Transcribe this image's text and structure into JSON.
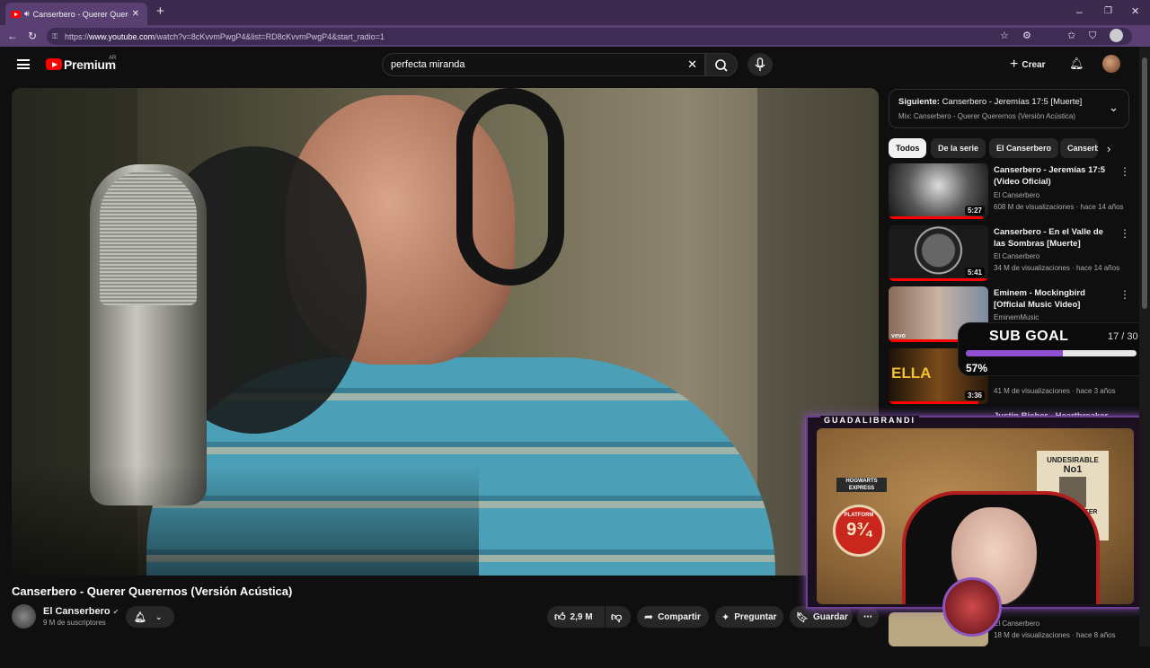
{
  "browser": {
    "tab_title": "Canserbero - Querer Querernos",
    "url_prefix": "https://",
    "url_domain": "www.youtube.com",
    "url_path": "/watch?v=8cKvvmPwgP4&list=RD8cKvvmPwgP4&start_radio=1"
  },
  "header": {
    "logo": "Premium",
    "region": "AR",
    "search_value": "perfecta miranda",
    "create_label": "Crear"
  },
  "video": {
    "title": "Canserbero - Querer Querernos (Versión Acústica)",
    "channel": "El Canserbero",
    "subscribers": "9 M de suscriptores",
    "likes": "2,9 M",
    "share": "Compartir",
    "ask": "Preguntar",
    "save": "Guardar"
  },
  "playlist": {
    "next_label": "Siguiente:",
    "next_title": "Canserbero - Jeremías 17:5 [Muerte]",
    "mix": "Mix: Canserbero - Querer Querernos (Versión Acústica)"
  },
  "chips": [
    "Todos",
    "De la serie",
    "El Canserbero",
    "Canserbero"
  ],
  "sidebar": [
    {
      "title": "Canserbero - Jeremías 17:5 (Video Oficial)",
      "channel": "El Canserbero",
      "meta": "608 M de visualizaciones · hace 14 años",
      "duration": "5:27",
      "progress": 0.95
    },
    {
      "title": "Canserbero - En el Valle de las Sombras [Muerte]",
      "channel": "El Canserbero",
      "meta": "34 M de visualizaciones · hace 14 años",
      "duration": "5:41",
      "progress": 1.0
    },
    {
      "title": "Eminem - Mockingbird [Official Music Video]",
      "channel": "EminemMusic",
      "meta": "",
      "duration": "",
      "progress": 0.9
    },
    {
      "title": "",
      "channel": "",
      "meta": "41 M de visualizaciones · hace 3 años",
      "duration": "3:36",
      "progress": 0.9
    },
    {
      "title": "Justin Bieber - Heartbreaker",
      "channel": "",
      "meta": "",
      "duration": "",
      "progress": 0
    },
    {
      "title": "",
      "channel": "El Canserbero",
      "meta": "18 M de visualizaciones · hace 8 años",
      "duration": "",
      "progress": 0
    }
  ],
  "overlay": {
    "goal_label": "SUB GOAL",
    "goal_count": "17 / 30",
    "goal_percent": "57%",
    "goal_fraction": 0.57,
    "streamer": "GUADALIBRANDI",
    "poster_line1": "UNDESIRABLE",
    "poster_line2": "No1",
    "poster_line3": "HARRY POTTER",
    "platform": "PLATFORM",
    "platform_num": "9¾",
    "hogwarts": "HOGWARTS EXPRESS"
  },
  "colors": {
    "accent": "#ff0000",
    "browser": "#5a3f73",
    "overlay": "#8c55c0"
  }
}
